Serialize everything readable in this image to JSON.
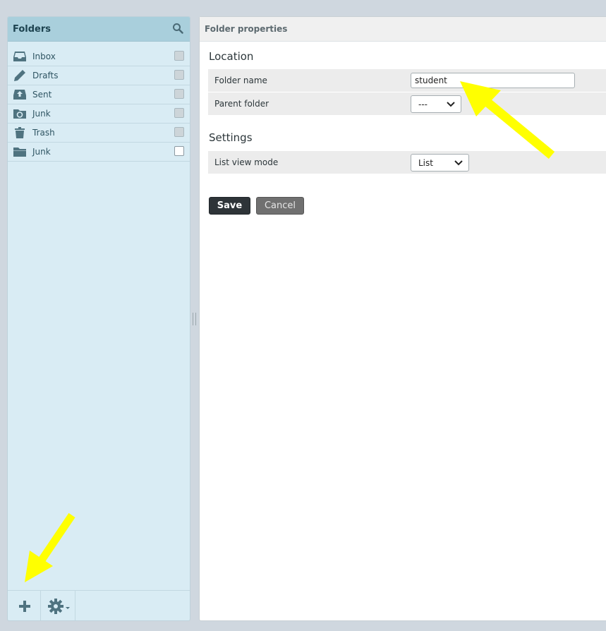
{
  "folders_panel": {
    "title": "Folders",
    "items": [
      {
        "label": "Inbox",
        "icon": "inbox-icon",
        "subscribed": false
      },
      {
        "label": "Drafts",
        "icon": "pencil-icon",
        "subscribed": false
      },
      {
        "label": "Sent",
        "icon": "sent-icon",
        "subscribed": false
      },
      {
        "label": "Junk",
        "icon": "junk-icon",
        "subscribed": false
      },
      {
        "label": "Trash",
        "icon": "trash-icon",
        "subscribed": false
      },
      {
        "label": "Junk",
        "icon": "folder-icon",
        "subscribed": true
      }
    ]
  },
  "properties": {
    "title": "Folder properties",
    "location_heading": "Location",
    "folder_name_label": "Folder name",
    "folder_name_value": "student",
    "parent_folder_label": "Parent folder",
    "parent_folder_value": "---",
    "settings_heading": "Settings",
    "list_view_mode_label": "List view mode",
    "list_view_mode_value": "List",
    "save_label": "Save",
    "cancel_label": "Cancel"
  },
  "colors": {
    "accent": "#a9cfdc",
    "panel": "#d9ecf4",
    "annotation_arrow": "#ffff00"
  }
}
